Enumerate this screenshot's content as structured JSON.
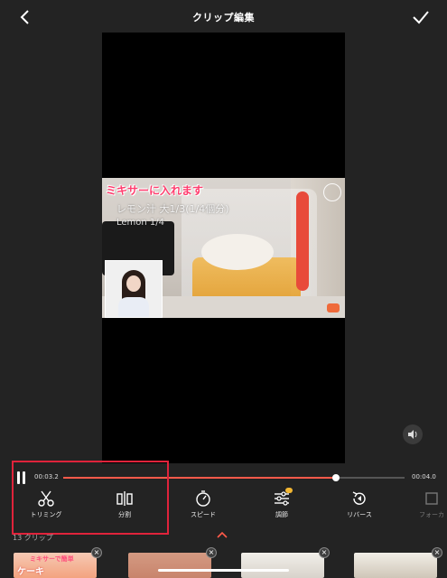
{
  "header": {
    "title": "クリップ編集"
  },
  "preview": {
    "caption_red": "ミキサーに入れます",
    "caption_line": "レモン汁 大1/3(1/4個分)",
    "caption_en": "Lemon 1/4"
  },
  "playback": {
    "current_time": "00:03.2",
    "end_time": "00:04.0",
    "progress": 0.8,
    "state": "playing"
  },
  "tools": [
    {
      "label": "トリミング",
      "icon": "scissors-icon"
    },
    {
      "label": "分割",
      "icon": "split-icon"
    },
    {
      "label": "スピード",
      "icon": "speed-icon"
    },
    {
      "label": "調節",
      "icon": "adjust-icon"
    },
    {
      "label": "リバース",
      "icon": "reverse-icon"
    },
    {
      "label": "フォーカ",
      "icon": "focus-icon"
    }
  ],
  "clips": {
    "count_label": "13 クリップ",
    "thumb1_text1": "ミキサーで簡単",
    "thumb1_text2": "ケーキ"
  },
  "colors": {
    "accent": "#ff5a4a",
    "highlight": "#e0233b",
    "caption": "#ff3d6e"
  }
}
